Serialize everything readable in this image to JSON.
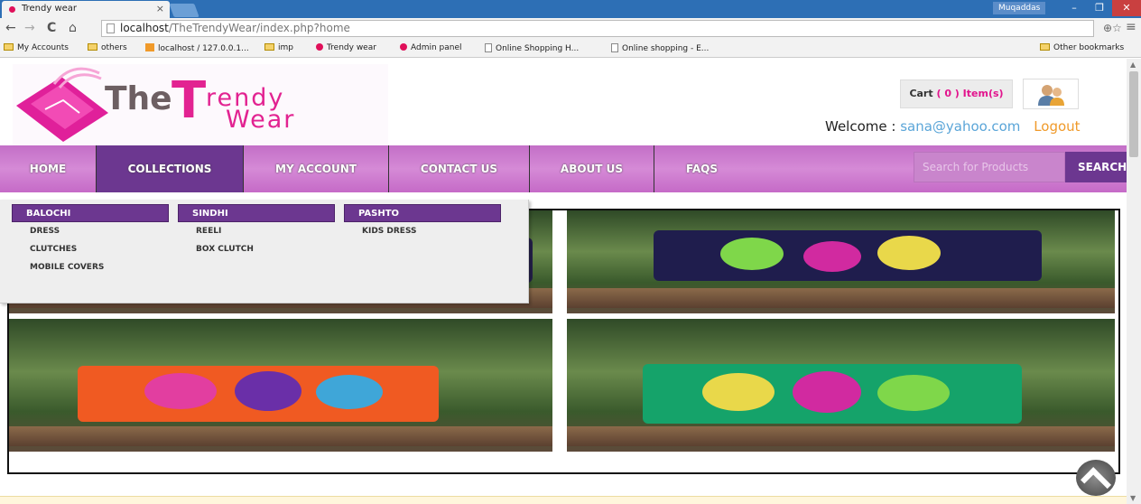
{
  "browser": {
    "tab_title": "Trendy wear",
    "tab_close": "×",
    "user_badge": "Muqaddas",
    "window_controls": {
      "minimize": "–",
      "restore": "❐",
      "close": "✕"
    },
    "nav": {
      "back": "←",
      "forward": "→",
      "reload": "C",
      "home": "⌂"
    },
    "url_host": "localhost",
    "url_path": "/TheTrendyWear/index.php?home",
    "addr_icons": {
      "zoom": "⊕",
      "star": "☆",
      "menu": "≡"
    },
    "bookmarks": [
      {
        "label": "My Accounts",
        "icon": "folder-icon"
      },
      {
        "label": "others",
        "icon": "folder-icon"
      },
      {
        "label": "localhost / 127.0.0.1...",
        "icon": "phpmyadmin-icon"
      },
      {
        "label": "imp",
        "icon": "folder-icon"
      },
      {
        "label": "Trendy wear",
        "icon": "site-dot-icon"
      },
      {
        "label": "Admin panel",
        "icon": "site-dot-icon"
      },
      {
        "label": "Online Shopping H...",
        "icon": "page-icon"
      },
      {
        "label": "Online shopping - E...",
        "icon": "page-icon"
      }
    ],
    "other_bookmarks": "Other bookmarks"
  },
  "header": {
    "logo": {
      "part1": "The",
      "part2": "T",
      "part3": "rendy",
      "part4": "Wear"
    },
    "cart_prefix": "Cart",
    "cart_count": "( 0 ) Item(s)",
    "welcome_label": "Welcome :",
    "user_email": "sana@yahoo.com",
    "logout": "Logout"
  },
  "nav": {
    "items": [
      "HOME",
      "COLLECTIONS",
      "MY ACCOUNT",
      "CONTACT US",
      "ABOUT US",
      "FAQS"
    ],
    "active_index": 1,
    "search_placeholder": "Search for Products",
    "search_button": "SEARCH"
  },
  "collections_menu": [
    {
      "heading": "BALOCHI",
      "links": [
        "DRESS",
        "CLUTCHES",
        "MOBILE COVERS"
      ]
    },
    {
      "heading": "SINDHI",
      "links": [
        "REELI",
        "BOX CLUTCH"
      ]
    },
    {
      "heading": "PASHTO",
      "links": [
        "KIDS DRESS"
      ]
    }
  ],
  "colors": {
    "brand_pink": "#e22391",
    "nav_purple": "#6c3790",
    "nav_bar": "#c97acb",
    "email_blue": "#5aa5d8",
    "logout_orange": "#f09a2a"
  }
}
